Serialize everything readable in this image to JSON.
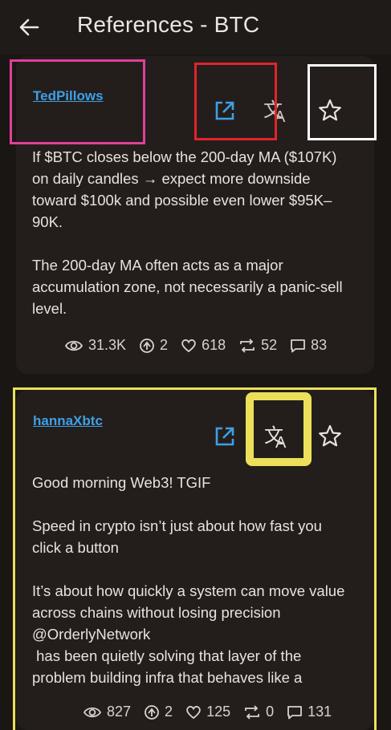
{
  "header": {
    "title": "References - BTC"
  },
  "posts": [
    {
      "author": "TedPillows",
      "text": "If $BTC closes below the 200-day MA ($107K) on daily candles → expect more downside toward $100k and possible even lower $95K–90K.\n\nThe 200-day MA often acts as a major accumulation zone, not necessarily a panic-sell level.",
      "stats": {
        "views": "31.3K",
        "boosts": "2",
        "likes": "618",
        "reposts": "52",
        "comments": "83"
      }
    },
    {
      "author": "hannaXbtc",
      "text": "Good morning Web3! TGIF\n\nSpeed in crypto isn’t just about how fast you click a button\n\nIt’s about how quickly a system can move value across chains without losing precision\n@OrderlyNetwork\n has been quietly solving that layer of the problem building infra that behaves like a",
      "stats": {
        "views": "827",
        "boosts": "2",
        "likes": "125",
        "reposts": "0",
        "comments": "131"
      }
    }
  ],
  "colors": {
    "accent": "#3ea0e6",
    "highlight_magenta": "#e0409a",
    "highlight_red": "#e0242c",
    "highlight_white": "#ffffff",
    "highlight_yellow": "#ece05a"
  }
}
